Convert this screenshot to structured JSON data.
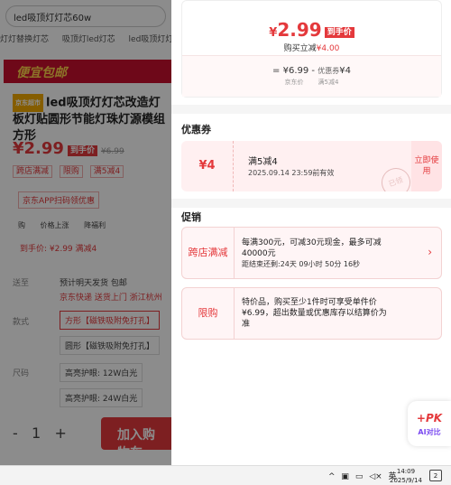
{
  "background_page": {
    "search_query": "led吸顶灯灯芯60w",
    "subnav": [
      "灯灯替换灯芯",
      "吸顶灯led灯芯",
      "led吸顶灯灯"
    ],
    "banner": "便宜包邮",
    "product": {
      "tag": "京东超市",
      "title": "led吸顶灯灯芯改造灯板灯贴圆形节能灯珠灯源模组 方形",
      "price": "¥2.99",
      "price_badge": "到手价",
      "original_price": "¥6.99",
      "promos": [
        "跨店满减",
        "限购",
        "满5减4"
      ],
      "qr_text": "京东APP扫码领优惠",
      "tools": [
        "购",
        "价格上涨",
        "降福利"
      ],
      "dsp_line": "到手价: ¥2.99  满减4"
    },
    "shipping": {
      "label": "送至",
      "value": "预计明天发货  包邮",
      "sub": "京东快递  送货上门  浙江杭州"
    },
    "style": {
      "label": "款式",
      "options": [
        "方形【磁铁吸附免打孔】",
        "圆形【磁铁吸附免打孔】"
      ]
    },
    "size": {
      "label": "尺码",
      "options": [
        "高亮护眼: 12W白光",
        "高亮护眼: 24W白光"
      ]
    },
    "quantity": {
      "minus": "-",
      "value": "1",
      "plus": "+"
    },
    "add_to_cart": "加入购物车"
  },
  "panel": {
    "price_summary": {
      "currency": "¥",
      "final_price": "2.99",
      "badge": "到手价",
      "sub_prefix": "购买立减",
      "sub_amount": "¥4.00",
      "calc_price": "= ¥6.99",
      "calc_minus": "-",
      "calc_coupon_label": "优惠券",
      "calc_coupon_value": "¥4",
      "caption_left": "京东价",
      "caption_right": "满5减4"
    },
    "coupons_title": "优惠券",
    "coupon": {
      "amount": "¥4",
      "title": "满5减4",
      "expiry": "2025.09.14 23:59前有效",
      "stamp": "已领",
      "use_button": "立即使用"
    },
    "promos_title": "促销",
    "promos": [
      {
        "type": "跨店满减",
        "line1": "每满300元，可减30元现金，最多可减",
        "line2": "40000元",
        "countdown": "距结束还剩:24天 09小时 50分 16秒"
      },
      {
        "type": "限购",
        "line1": "特价品，购买至少1件时可享受单件价",
        "line2": "¥6.99，超出数量或优惠库存以结算价为",
        "line3": "准"
      }
    ]
  },
  "floating": {
    "pk_label": "+PK",
    "ai_label": "AI对比"
  },
  "taskbar": {
    "ime": "英",
    "time": "14:09",
    "date": "2025/9/14",
    "notify_count": "2"
  }
}
